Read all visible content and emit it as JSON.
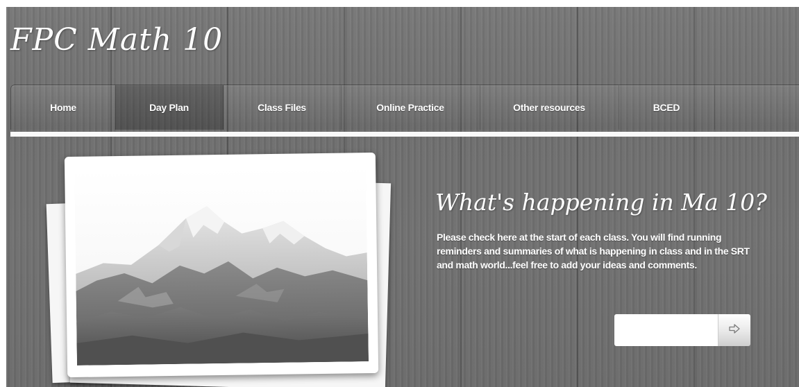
{
  "site": {
    "title": "FPC Math 10"
  },
  "nav": {
    "items": [
      {
        "label": "Home"
      },
      {
        "label": "Day Plan",
        "active": true
      },
      {
        "label": "Class Files"
      },
      {
        "label": "Online Practice"
      },
      {
        "label": "Other resources"
      },
      {
        "label": "BCED"
      }
    ]
  },
  "hero": {
    "heading": "What's happening in Ma 10?",
    "body": "Please check here at the start of each class.  You will find running reminders and summaries of what is happening in class and in the SRT and math world...feel free to add your ideas and comments.",
    "input": {
      "value": "",
      "placeholder": ""
    },
    "button_icon": "arrow-right-icon"
  },
  "image": {
    "subject": "mountain-photo"
  },
  "colors": {
    "background": "#707070",
    "text": "#ffffff",
    "nav_active": "#5a5a5a"
  }
}
